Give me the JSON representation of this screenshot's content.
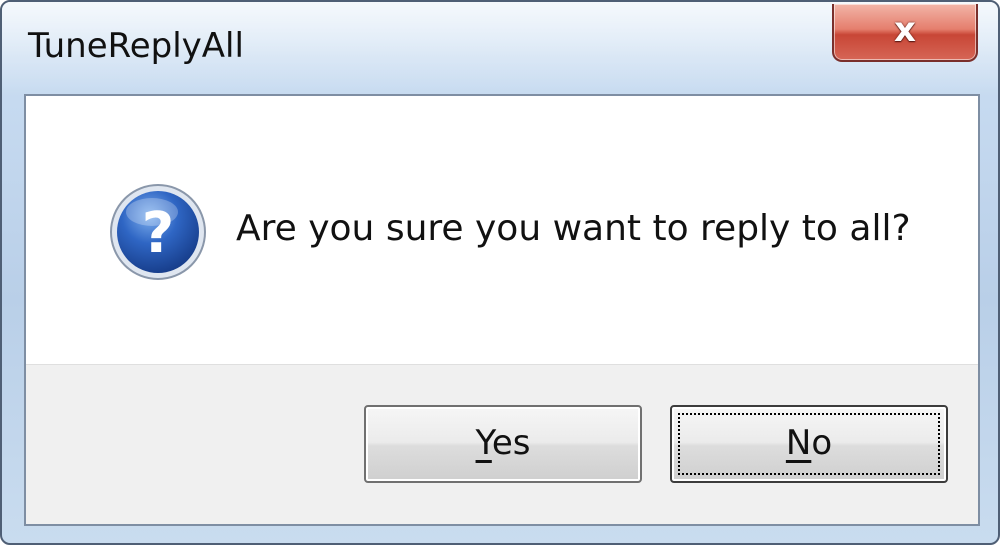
{
  "window": {
    "title": "TuneReplyAll",
    "close_glyph": "x"
  },
  "message": {
    "icon": "question-icon",
    "text": "Are you sure you want to reply to all?"
  },
  "buttons": {
    "yes": {
      "mnemonic": "Y",
      "rest": "es"
    },
    "no": {
      "mnemonic": "N",
      "rest": "o",
      "focused": true
    }
  },
  "colors": {
    "titlebar": "#c6daf0",
    "close_button": "#c84636",
    "icon_blue": "#1f4fa6",
    "button_bar": "#f0f0f0"
  }
}
